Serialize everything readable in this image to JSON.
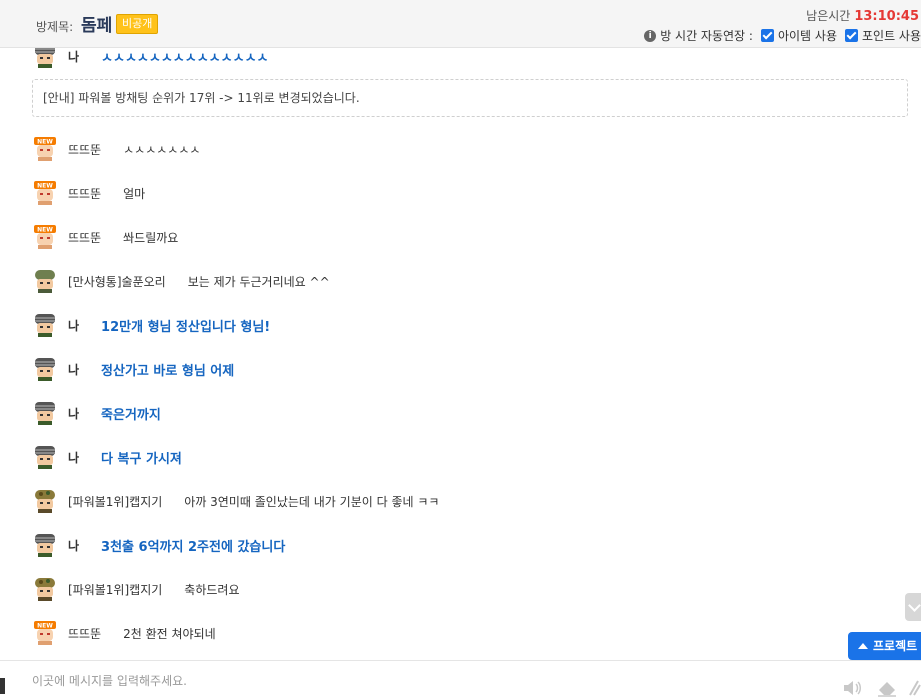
{
  "header": {
    "room_label": "방제목:",
    "room_title": "돔페",
    "private_badge": "비공개",
    "timer_label": "남은시간",
    "timer_value": "13:10:45",
    "auto_extend_label": "방 시간 자동연장 :",
    "item_use_label": "아이템 사용",
    "point_use_label": "포인트 사용"
  },
  "notice": "[안내] 파워볼 방채팅 순위가 17위 -> 11위로 변경되었습니다.",
  "messages": [
    {
      "avatar": "helmet-avatar",
      "nick": "나",
      "text": "ㅅㅅㅅㅅㅅㅅㅅㅅㅅㅅㅅㅅㅅㅅ",
      "me": true
    },
    {
      "avatar": "new-user-avatar",
      "nick": "뜨뜨뚠",
      "text": "ㅅㅅㅅㅅㅅㅅㅅ",
      "me": false
    },
    {
      "avatar": "new-user-avatar",
      "nick": "뜨뜨뚠",
      "text": "얼마",
      "me": false
    },
    {
      "avatar": "new-user-avatar",
      "nick": "뜨뜨뚠",
      "text": "쏴드릴까요",
      "me": false
    },
    {
      "avatar": "soldier-avatar",
      "nick": "[만사형통]술푼오리",
      "text": "보는 제가 두근거리네요 ^^",
      "me": false
    },
    {
      "avatar": "helmet-avatar",
      "nick": "나",
      "text": "12만개 형님 정산입니다 형님!",
      "me": true
    },
    {
      "avatar": "helmet-avatar",
      "nick": "나",
      "text": "정산가고 바로 형님 어제",
      "me": true
    },
    {
      "avatar": "helmet-avatar",
      "nick": "나",
      "text": "죽은거까지",
      "me": true
    },
    {
      "avatar": "helmet-avatar",
      "nick": "나",
      "text": "다 복구 가시져",
      "me": true
    },
    {
      "avatar": "camo-avatar",
      "nick": "[파워볼1위]캡지기",
      "text": "아까 3연미때 졸인났는데 내가 기분이 다 좋네 ㅋㅋ",
      "me": false
    },
    {
      "avatar": "helmet-avatar",
      "nick": "나",
      "text": "3천출 6억까지 2주전에 갔습니다",
      "me": true
    },
    {
      "avatar": "camo-avatar",
      "nick": "[파워볼1위]캡지기",
      "text": "축하드려요",
      "me": false
    },
    {
      "avatar": "new-user-avatar",
      "nick": "뜨뜨뚠",
      "text": "2천 환전 쳐야되네",
      "me": false
    }
  ],
  "project_button": "프로젝트",
  "input": {
    "placeholder": "이곳에 메시지를 입력해주세요.",
    "value": ""
  },
  "icons": {
    "info": "info-icon",
    "speaker": "speaker-icon",
    "eraser": "eraser-icon",
    "scroll": "chevron-down-icon"
  },
  "colors": {
    "accent": "#1a73e8",
    "timer": "#e53935",
    "badge": "#ffc21a",
    "my_message": "#1565c0"
  }
}
